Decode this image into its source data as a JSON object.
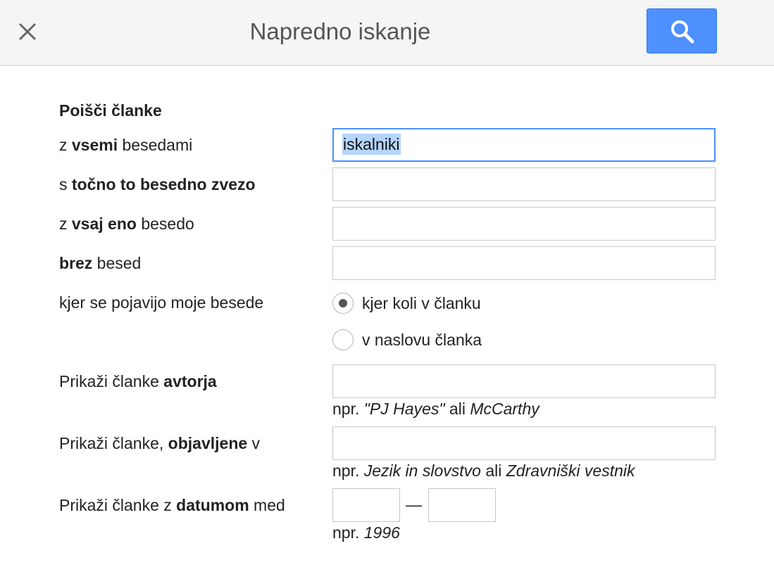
{
  "header": {
    "title": "Napredno iskanje",
    "close_icon": "close-icon",
    "search_icon": "search-icon",
    "accent_color": "#4d90fe"
  },
  "form": {
    "section_title": "Poišči članke",
    "all_words": {
      "prefix": "z ",
      "bold": "vsemi",
      "suffix": " besedami",
      "value": "iskalniki"
    },
    "exact_phrase": {
      "prefix": "s ",
      "bold": "točno to besedno zvezo",
      "suffix": "",
      "value": ""
    },
    "any_word": {
      "prefix": "z ",
      "bold": "vsaj eno",
      "suffix": " besedo",
      "value": ""
    },
    "without_words": {
      "prefix": "",
      "bold": "brez",
      "suffix": " besed",
      "value": ""
    },
    "occurrence": {
      "label": "kjer se pojavijo moje besede",
      "options": [
        {
          "label": "kjer koli v članku",
          "selected": true
        },
        {
          "label": "v naslovu članka",
          "selected": false
        }
      ]
    },
    "author": {
      "prefix": "Prikaži članke ",
      "bold": "avtorja",
      "suffix": "",
      "value": "",
      "hint_prefix": "npr. ",
      "hint_example1": "\"PJ Hayes\"",
      "hint_middle": " ali ",
      "hint_example2": "McCarthy"
    },
    "publication": {
      "prefix": "Prikaži članke, ",
      "bold": "objavljene",
      "suffix": " v",
      "value": "",
      "hint_prefix": "npr. ",
      "hint_example1": "Jezik in slovstvo",
      "hint_middle": " ali ",
      "hint_example2": "Zdravniški vestnik"
    },
    "date_range": {
      "prefix": "Prikaži članke z ",
      "bold": "datumom",
      "suffix": " med",
      "from_value": "",
      "to_value": "",
      "separator": "—",
      "hint_prefix": "npr. ",
      "hint_example": "1996"
    }
  }
}
